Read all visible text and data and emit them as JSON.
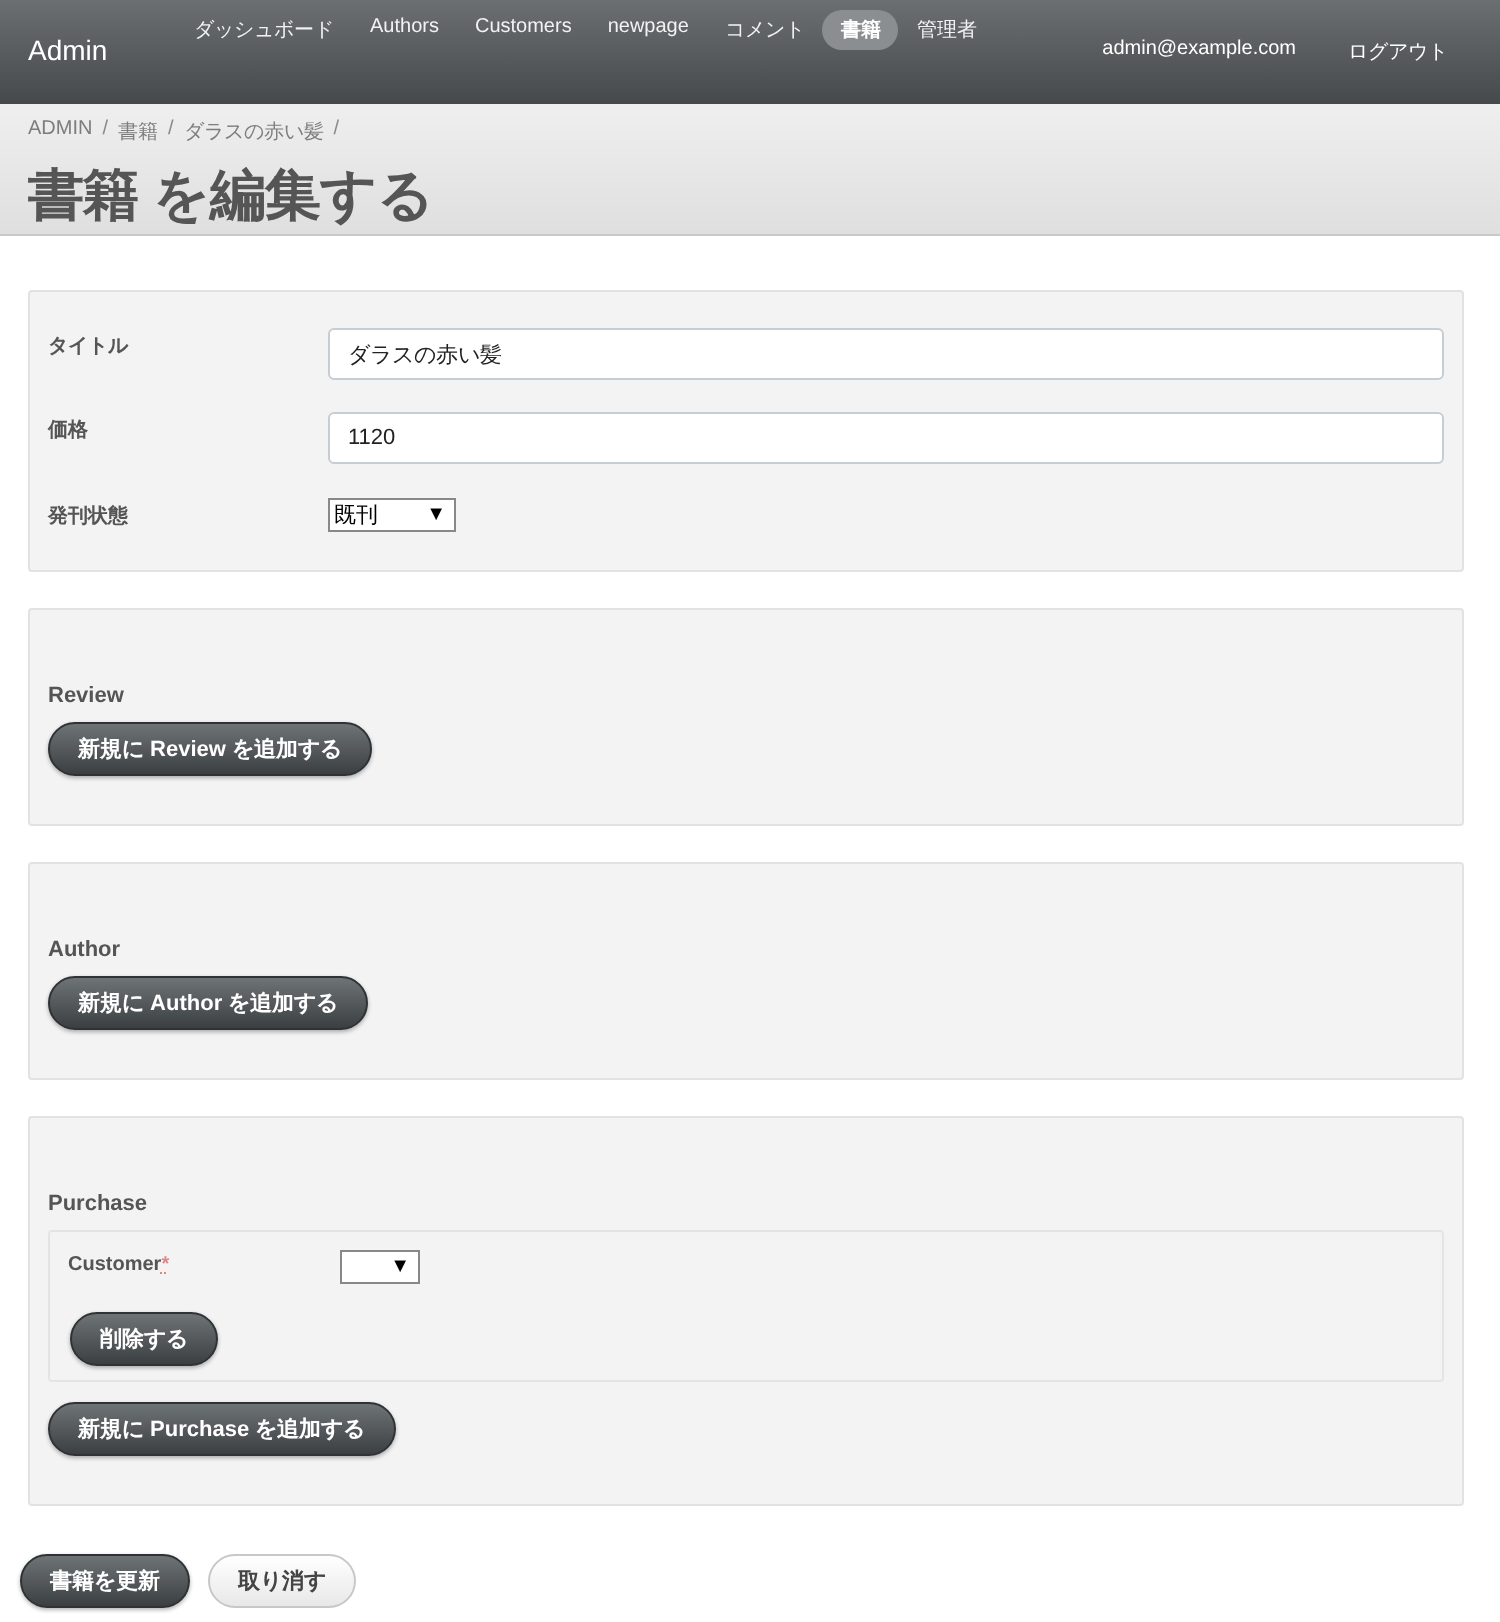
{
  "header": {
    "brand": "Admin",
    "nav": [
      {
        "label": "ダッシュボード",
        "selected": false
      },
      {
        "label": "Authors",
        "selected": false
      },
      {
        "label": "Customers",
        "selected": false
      },
      {
        "label": "newpage",
        "selected": false
      },
      {
        "label": "コメント",
        "selected": false
      },
      {
        "label": "書籍",
        "selected": true
      },
      {
        "label": "管理者",
        "selected": false
      }
    ],
    "user": "admin@example.com",
    "logout": "ログアウト"
  },
  "breadcrumbs": [
    "ADMIN",
    "書籍",
    "ダラスの赤い髪"
  ],
  "breadcrumb_separator": "/",
  "page_title": "書籍 を編集する",
  "fields": [
    {
      "kind": "text",
      "label": "タイトル",
      "value": "ダラスの赤い髪"
    },
    {
      "kind": "text",
      "label": "価格",
      "value": "1120"
    },
    {
      "kind": "select",
      "label": "発刊状態",
      "value": "既刊",
      "arrow": "▼"
    }
  ],
  "sections": [
    {
      "title": "Review",
      "add_button": "新規に Review を追加する"
    },
    {
      "title": "Author",
      "add_button": "新規に Author を追加する"
    },
    {
      "title": "Purchase",
      "items": [
        {
          "label": "Customer",
          "required_mark": "*",
          "value": "",
          "arrow": "▼",
          "delete_button": "削除する"
        }
      ],
      "add_button": "新規に Purchase を追加する"
    }
  ],
  "actions": [
    {
      "kind": "primary",
      "label": "書籍を更新"
    },
    {
      "kind": "secondary",
      "label": "取り消す"
    }
  ]
}
